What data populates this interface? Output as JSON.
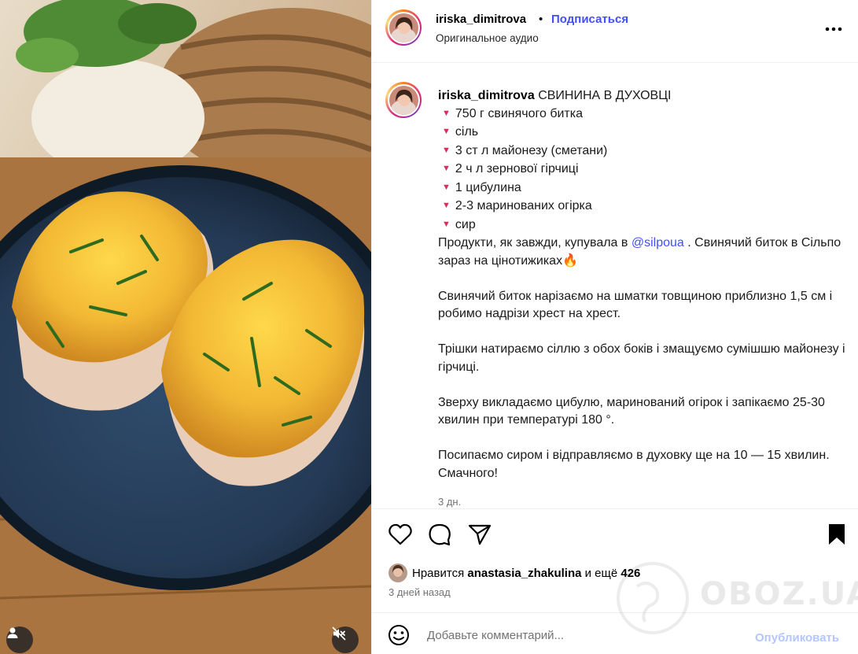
{
  "post": {
    "username": "iriska_dimitrova",
    "separator": "•",
    "follow_label": "Подписаться",
    "audio_label": "Оригинальное аудио"
  },
  "caption": {
    "username": "iriska_dimitrova",
    "title": "СВИНИНА В ДУХОВЦІ",
    "ingredients": [
      "750 г свинячого битка",
      "сіль",
      "3 ст л майонезу (сметани)",
      "2 ч л зернової гірчиці",
      "1 цибулина",
      "2-3 маринованих огірка",
      "сир"
    ],
    "p1_before": "Продукти, як завжди, купувала в ",
    "p1_mention": "@silpoua",
    "p1_after": " . Свинячий биток в Сільпо зараз на цінотижиках",
    "p1_emoji": "🔥",
    "p2": "Свинячий биток нарізаємо на шматки товщиною приблизно 1,5 см і робимо надрізи хрест на хрест.",
    "p3": "Трішки натираємо сіллю з обох боків і змащуємо сумішшю майонезу і гірчиці.",
    "p4": "Зверху викладаємо цибулю, маринований огірок і запікаємо 25-30 хвилин при температурі 180 °.",
    "p5": "Посипаємо сиром і відправляємо в духовку ще на 10 — 15 хвилин. Смачного!",
    "age": "3 дн."
  },
  "likes": {
    "prefix": "Нравится",
    "user": "anastasia_zhakulina",
    "middle": "и ещё",
    "count": "426"
  },
  "posted_ago": "3 дней назад",
  "comment": {
    "placeholder": "Добавьте комментарий...",
    "publish_label": "Опубликовать"
  },
  "watermark": "OBOZ.UA",
  "icons": {
    "more": "more-horizontal-icon",
    "like": "heart-outline-icon",
    "comment": "comment-bubble-icon",
    "share": "paper-plane-icon",
    "save": "bookmark-filled-icon",
    "emoji": "smiley-icon",
    "user": "user-tag-icon",
    "mute": "speaker-muted-icon"
  },
  "colors": {
    "link": "#4150f7",
    "bullet": "#dd2a5b",
    "muted": "#737373",
    "publish_disabled": "#b3c6ff",
    "border": "#efefef"
  }
}
